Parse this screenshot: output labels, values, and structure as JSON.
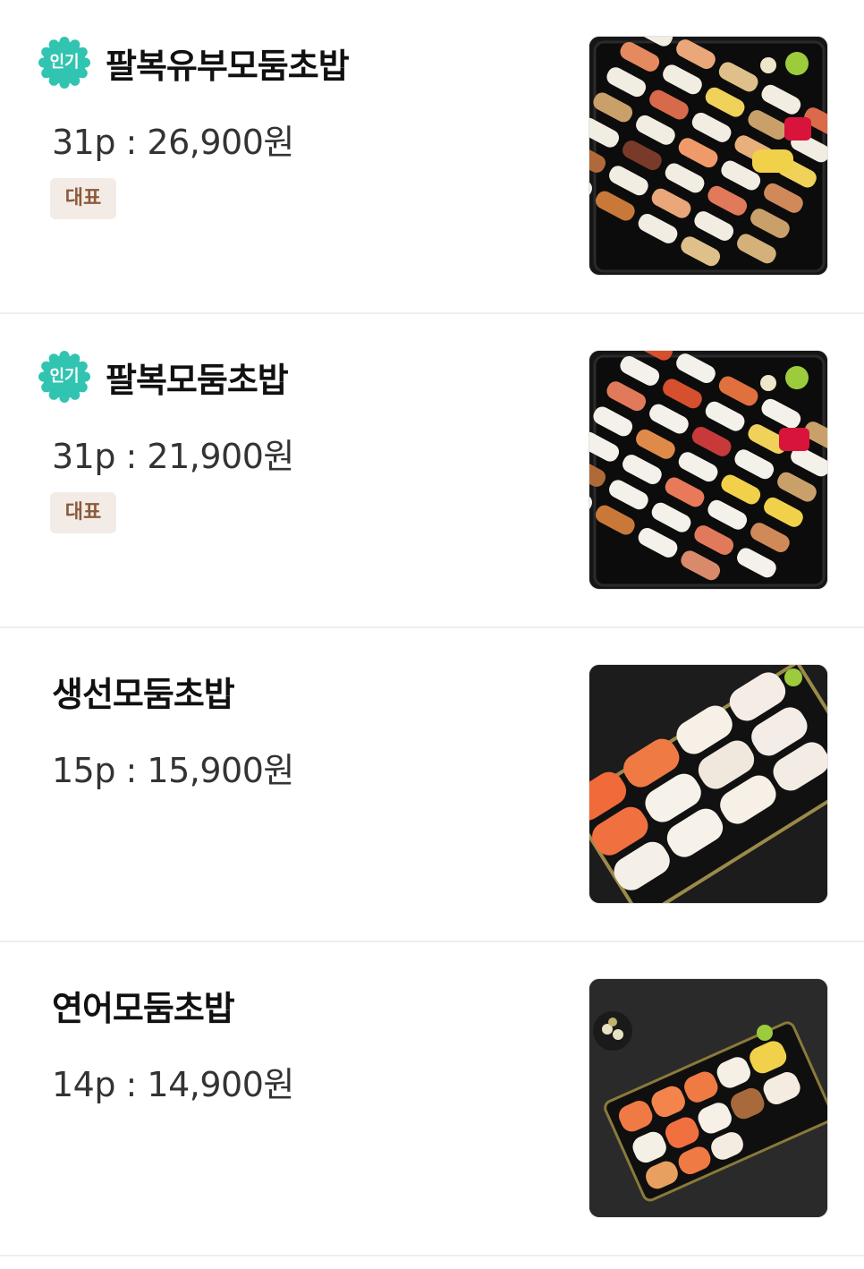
{
  "colors": {
    "popular_badge": "#31c4b0",
    "rep_tag_bg": "#f3ece6",
    "rep_tag_text": "#8a5a3b",
    "divider": "#efefef"
  },
  "menu": {
    "items": [
      {
        "name": "팔복유부모둠초밥",
        "price": "31p : 26,900원",
        "badge": "인기",
        "tag": "대표",
        "image": "sushi-platter-inari"
      },
      {
        "name": "팔복모둠초밥",
        "price": "31p : 21,900원",
        "badge": "인기",
        "tag": "대표",
        "image": "sushi-platter-assorted"
      },
      {
        "name": "생선모둠초밥",
        "price": "15p : 15,900원",
        "badge": null,
        "tag": null,
        "image": "sushi-fish-assorted"
      },
      {
        "name": "연어모둠초밥",
        "price": "14p : 14,900원",
        "badge": null,
        "tag": null,
        "image": "sushi-salmon-assorted"
      }
    ]
  }
}
